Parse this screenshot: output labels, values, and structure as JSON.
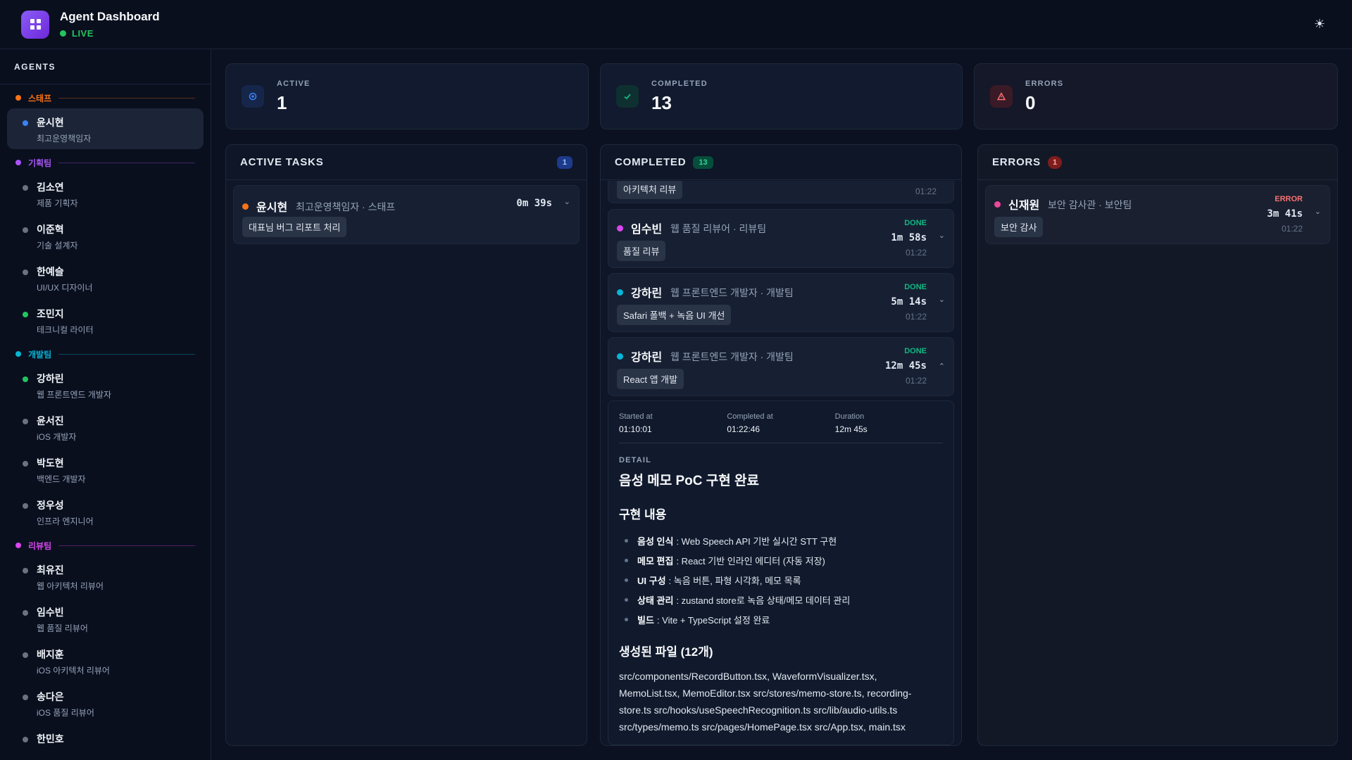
{
  "app": {
    "title": "Agent Dashboard",
    "live_label": "LIVE",
    "theme_icon": "☀"
  },
  "sidebar": {
    "title": "AGENTS",
    "groups": [
      {
        "label": "스태프",
        "color": "#f97316",
        "agents": [
          {
            "name": "윤시현",
            "role": "최고운영책임자",
            "status_color": "#3b82f6",
            "selected": true
          }
        ]
      },
      {
        "label": "기획팀",
        "color": "#a855f7",
        "agents": [
          {
            "name": "김소연",
            "role": "제품 기획자",
            "status_color": "#6b7280"
          },
          {
            "name": "이준혁",
            "role": "기술 설계자",
            "status_color": "#6b7280"
          },
          {
            "name": "한예슬",
            "role": "UI/UX 디자이너",
            "status_color": "#6b7280"
          },
          {
            "name": "조민지",
            "role": "테크니컬 라이터",
            "status_color": "#22c55e"
          }
        ]
      },
      {
        "label": "개발팀",
        "color": "#06b6d4",
        "agents": [
          {
            "name": "강하린",
            "role": "웹 프론트엔드 개발자",
            "status_color": "#22c55e"
          },
          {
            "name": "윤서진",
            "role": "iOS 개발자",
            "status_color": "#6b7280"
          },
          {
            "name": "박도현",
            "role": "백엔드 개발자",
            "status_color": "#6b7280"
          },
          {
            "name": "정우성",
            "role": "인프라 엔지니어",
            "status_color": "#6b7280"
          }
        ]
      },
      {
        "label": "리뷰팀",
        "color": "#d946ef",
        "agents": [
          {
            "name": "최유진",
            "role": "웹 아키텍처 리뷰어",
            "status_color": "#6b7280"
          },
          {
            "name": "임수빈",
            "role": "웹 품질 리뷰어",
            "status_color": "#6b7280"
          },
          {
            "name": "배지훈",
            "role": "iOS 아키텍처 리뷰어",
            "status_color": "#6b7280"
          },
          {
            "name": "송다은",
            "role": "iOS 품질 리뷰어",
            "status_color": "#6b7280"
          },
          {
            "name": "한민호",
            "role": "",
            "status_color": "#6b7280"
          }
        ]
      }
    ]
  },
  "stats": {
    "active": {
      "label": "ACTIVE",
      "value": "1",
      "icon": "record-icon"
    },
    "completed": {
      "label": "COMPLETED",
      "value": "13",
      "icon": "check-icon"
    },
    "errors": {
      "label": "ERRORS",
      "value": "0",
      "icon": "warning-icon"
    }
  },
  "active_panel": {
    "title": "ACTIVE TASKS",
    "count": "1",
    "tasks": [
      {
        "name": "윤시현",
        "role": "최고운영책임자 · 스태프",
        "tag": "대표님 버그 리포트 처리",
        "duration": "0m 39s"
      }
    ]
  },
  "completed_panel": {
    "title": "COMPLETED",
    "count": "13",
    "tasks": [
      {
        "tag": "아키텍처 리뷰",
        "time": "01:22"
      },
      {
        "name": "임수빈",
        "role": "웹 품질 리뷰어 · 리뷰팀",
        "tag": "품질 리뷰",
        "status": "DONE",
        "duration": "1m 58s",
        "time": "01:22"
      },
      {
        "name": "강하린",
        "role": "웹 프론트엔드 개발자 · 개발팀",
        "tag": "Safari 폴백 + 녹음 UI 개선",
        "status": "DONE",
        "duration": "5m 14s",
        "time": "01:22"
      },
      {
        "name": "강하린",
        "role": "웹 프론트엔드 개발자 · 개발팀",
        "tag": "React 앱 개발",
        "status": "DONE",
        "duration": "12m 45s",
        "time": "01:22"
      }
    ],
    "detail": {
      "started_label": "Started at",
      "started": "01:10:01",
      "completed_label": "Completed at",
      "completed": "01:22:46",
      "duration_label": "Duration",
      "duration": "12m 45s",
      "section_label": "DETAIL",
      "title": "음성 메모 PoC 구현 완료",
      "impl_heading": "구현 내용",
      "bullets": [
        {
          "key": "음성 인식",
          "text": ": Web Speech API 기반 실시간 STT 구현"
        },
        {
          "key": "메모 편집",
          "text": ": React 기반 인라인 에디터 (자동 저장)"
        },
        {
          "key": "UI 구성",
          "text": ": 녹음 버튼, 파형 시각화, 메모 목록"
        },
        {
          "key": "상태 관리",
          "text": ": zustand store로 녹음 상태/메모 데이터 관리"
        },
        {
          "key": "빌드",
          "text": ": Vite + TypeScript 설정 완료"
        }
      ],
      "files_heading": "생성된 파일 (12개)",
      "files": "src/components/RecordButton.tsx, WaveformVisualizer.tsx, MemoList.tsx, MemoEditor.tsx src/stores/memo-store.ts, recording-store.ts src/hooks/useSpeechRecognition.ts src/lib/audio-utils.ts src/types/memo.ts src/pages/HomePage.tsx src/App.tsx, main.tsx"
    }
  },
  "errors_panel": {
    "title": "ERRORS",
    "count": "1",
    "tasks": [
      {
        "name": "신재원",
        "role": "보안 감사관 · 보안팀",
        "tag": "보안 감사",
        "status": "ERROR",
        "duration": "3m 41s",
        "time": "01:22"
      }
    ]
  },
  "colors": {
    "done": "#10b981",
    "error": "#f87171",
    "review_dot": "#d946ef",
    "dev_dot": "#06b6d4",
    "active_dot": "#f97316",
    "error_dot": "#ec4899"
  }
}
